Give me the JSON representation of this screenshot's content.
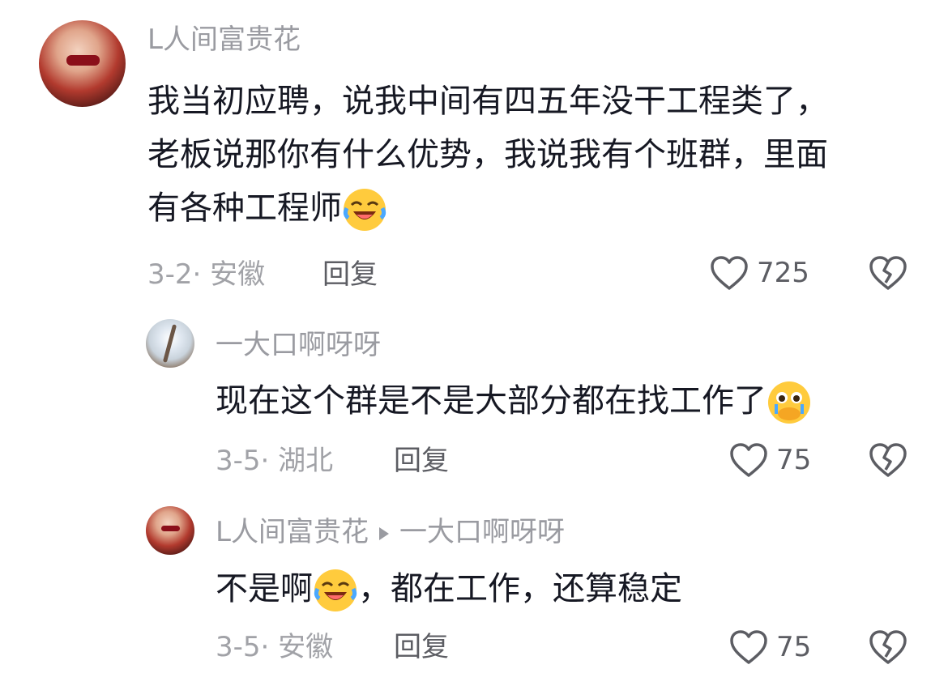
{
  "comments": [
    {
      "author": "L人间富贵花",
      "lines": [
        "我当初应聘，说我中间有四五年没干工程类了，",
        "老板说那你有什么优势，我说我有个班群，里面",
        "有各种工程师"
      ],
      "emoji": "laughing-crying-emoji",
      "date_location": "3-2· 安徽",
      "reply_label": "回复",
      "likes": "725"
    },
    {
      "author": "一大口啊呀呀",
      "text": "现在这个群是不是大部分都在找工作了",
      "emoji": "pleading-hands-emoji",
      "date_location": "3-5· 湖北",
      "reply_label": "回复",
      "likes": "75"
    },
    {
      "author": "L人间富贵花",
      "reply_to": "一大口啊呀呀",
      "text_before": "不是啊",
      "emoji": "laughing-crying-emoji",
      "text_after": "，都在工作，还算稳定",
      "date_location": "3-5· 安徽",
      "reply_label": "回复",
      "likes": "75"
    }
  ],
  "colors": {
    "name": "#9a9ba1",
    "text": "#161823",
    "meta": "#a1a2a7",
    "action": "#5c5d63"
  }
}
